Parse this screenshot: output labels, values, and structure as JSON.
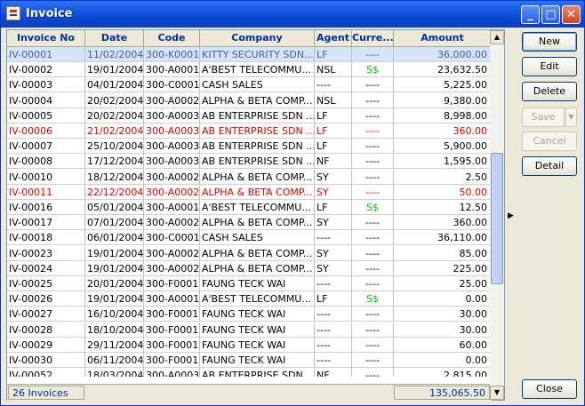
{
  "window": {
    "title": "Invoice"
  },
  "columns": [
    "Invoice No",
    "Date",
    "Code",
    "Company",
    "Agent",
    "Curre...",
    "Amount"
  ],
  "rows": [
    {
      "inv": "IV-00001",
      "date": "11/02/2004",
      "code": "300-K0001",
      "company": "KITTY SECURITY SDN...",
      "agent": "LF",
      "cur": "----",
      "amount": "36,000.00",
      "state": "selected"
    },
    {
      "inv": "IV-00002",
      "date": "19/01/2004",
      "code": "300-A0001",
      "company": "A'BEST TELECOMMU...",
      "agent": "NSL",
      "cur": "S$",
      "amount": "23,632.50",
      "state": "normal"
    },
    {
      "inv": "IV-00003",
      "date": "04/01/2004",
      "code": "300-C0001",
      "company": "CASH SALES",
      "agent": "----",
      "cur": "----",
      "amount": "5,225.00",
      "state": "normal"
    },
    {
      "inv": "IV-00004",
      "date": "20/02/2004",
      "code": "300-A0002",
      "company": "ALPHA & BETA COMP...",
      "agent": "NSL",
      "cur": "----",
      "amount": "9,380.00",
      "state": "normal"
    },
    {
      "inv": "IV-00005",
      "date": "20/02/2004",
      "code": "300-A0003",
      "company": "AB ENTERPRISE SDN ...",
      "agent": "LF",
      "cur": "----",
      "amount": "8,998.00",
      "state": "normal"
    },
    {
      "inv": "IV-00006",
      "date": "21/02/2004",
      "code": "300-A0003",
      "company": "AB ENTERPRISE SDN ...",
      "agent": "LF",
      "cur": "----",
      "amount": "360.00",
      "state": "red"
    },
    {
      "inv": "IV-00007",
      "date": "25/10/2004",
      "code": "300-A0003",
      "company": "AB ENTERPRISE SDN ...",
      "agent": "LF",
      "cur": "----",
      "amount": "5,900.00",
      "state": "normal"
    },
    {
      "inv": "IV-00008",
      "date": "17/12/2004",
      "code": "300-A0003",
      "company": "AB ENTERPRISE SDN ...",
      "agent": "NF",
      "cur": "----",
      "amount": "1,595.00",
      "state": "normal"
    },
    {
      "inv": "IV-00010",
      "date": "18/12/2004",
      "code": "300-A0002",
      "company": "ALPHA & BETA COMP...",
      "agent": "SY",
      "cur": "----",
      "amount": "2.50",
      "state": "normal"
    },
    {
      "inv": "IV-00011",
      "date": "22/12/2004",
      "code": "300-A0002",
      "company": "ALPHA & BETA COMP...",
      "agent": "SY",
      "cur": "----",
      "amount": "50.00",
      "state": "red"
    },
    {
      "inv": "IV-00016",
      "date": "05/01/2004",
      "code": "300-A0001",
      "company": "A'BEST TELECOMMU...",
      "agent": "LF",
      "cur": "S$",
      "amount": "12.50",
      "state": "normal"
    },
    {
      "inv": "IV-00017",
      "date": "07/01/2004",
      "code": "300-A0002",
      "company": "ALPHA & BETA COMP...",
      "agent": "SY",
      "cur": "----",
      "amount": "360.00",
      "state": "normal"
    },
    {
      "inv": "IV-00018",
      "date": "06/01/2004",
      "code": "300-C0001",
      "company": "CASH SALES",
      "agent": "----",
      "cur": "----",
      "amount": "36,110.00",
      "state": "normal"
    },
    {
      "inv": "IV-00023",
      "date": "19/01/2004",
      "code": "300-A0002",
      "company": "ALPHA & BETA COMP...",
      "agent": "SY",
      "cur": "----",
      "amount": "85.00",
      "state": "normal"
    },
    {
      "inv": "IV-00024",
      "date": "19/01/2004",
      "code": "300-A0002",
      "company": "ALPHA & BETA COMP...",
      "agent": "SY",
      "cur": "----",
      "amount": "225.00",
      "state": "normal"
    },
    {
      "inv": "IV-00025",
      "date": "20/01/2004",
      "code": "300-F0001",
      "company": "FAUNG TECK WAI",
      "agent": "----",
      "cur": "----",
      "amount": "25.00",
      "state": "normal"
    },
    {
      "inv": "IV-00026",
      "date": "19/01/2004",
      "code": "300-A0001",
      "company": "A'BEST TELECOMMU...",
      "agent": "LF",
      "cur": "S$",
      "amount": "0.00",
      "state": "normal"
    },
    {
      "inv": "IV-00027",
      "date": "16/10/2004",
      "code": "300-F0001",
      "company": "FAUNG TECK WAI",
      "agent": "----",
      "cur": "----",
      "amount": "30.00",
      "state": "normal"
    },
    {
      "inv": "IV-00028",
      "date": "18/10/2004",
      "code": "300-F0001",
      "company": "FAUNG TECK WAI",
      "agent": "----",
      "cur": "----",
      "amount": "30.00",
      "state": "normal"
    },
    {
      "inv": "IV-00029",
      "date": "29/11/2004",
      "code": "300-F0001",
      "company": "FAUNG TECK WAI",
      "agent": "----",
      "cur": "----",
      "amount": "60.00",
      "state": "normal"
    },
    {
      "inv": "IV-00030",
      "date": "06/11/2004",
      "code": "300-F0001",
      "company": "FAUNG TECK WAI",
      "agent": "----",
      "cur": "----",
      "amount": "0.00",
      "state": "normal"
    },
    {
      "inv": "IV-00052",
      "date": "18/03/2004",
      "code": "300-A0003",
      "company": "AB ENTERPRISE SDN ...",
      "agent": "NF",
      "cur": "----",
      "amount": "2,815.00",
      "state": "normal"
    }
  ],
  "footer": {
    "count": "26 Invoices",
    "total": "135,065.50"
  },
  "buttons": {
    "new": "New",
    "edit": "Edit",
    "delete": "Delete",
    "save": "Save",
    "cancel": "Cancel",
    "detail": "Detail",
    "close": "Close"
  },
  "colors": {
    "selected_row_bg": "#d6e4f7",
    "red_text": "#e00000",
    "currency_green": "#00c000",
    "header_text": "#003399"
  }
}
